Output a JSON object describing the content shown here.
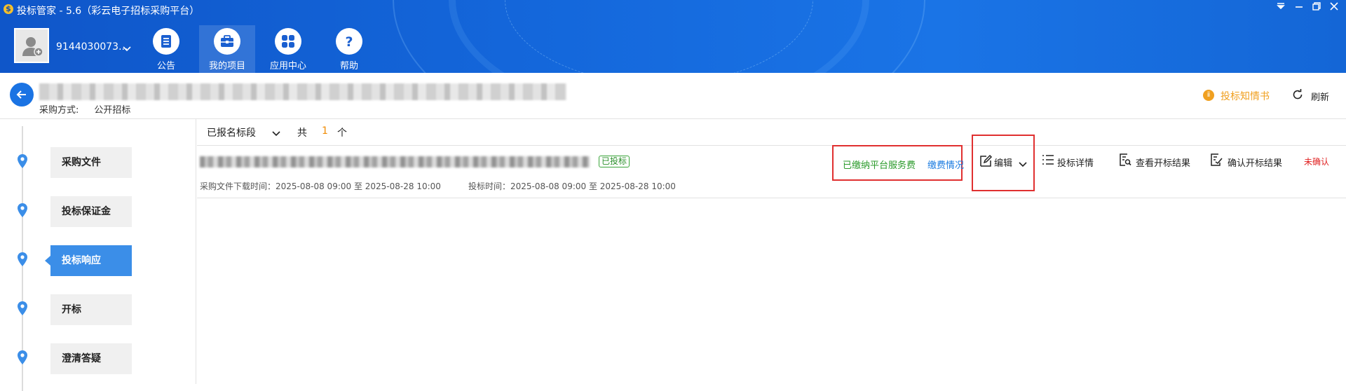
{
  "window": {
    "title": "投标管家 - 5.6（彩云电子招标采购平台）",
    "controls": [
      "dropdown-icon",
      "minimize-icon",
      "restore-icon",
      "close-icon"
    ]
  },
  "header": {
    "account": "9144030073...",
    "nav": [
      {
        "label": "公告",
        "icon": "notice-icon",
        "active": false
      },
      {
        "label": "我的项目",
        "icon": "briefcase-icon",
        "active": true
      },
      {
        "label": "应用中心",
        "icon": "apps-icon",
        "active": false
      },
      {
        "label": "帮助",
        "icon": "help-icon",
        "active": false
      }
    ]
  },
  "project": {
    "method_label": "采购方式:",
    "method_value": "公开招标",
    "guide_label": "投标知情书",
    "refresh_label": "刷新"
  },
  "steps": [
    {
      "label": "采购文件",
      "active": false
    },
    {
      "label": "投标保证金",
      "active": false
    },
    {
      "label": "投标响应",
      "active": true
    },
    {
      "label": "开标",
      "active": false
    },
    {
      "label": "澄清答疑",
      "active": false
    }
  ],
  "toolbar": {
    "segment_label": "已报名标段",
    "total_prefix": "共",
    "total_count": "1",
    "total_unit": "个"
  },
  "lot": {
    "badge": "已投标",
    "download_time": "采购文件下载时间：2025-08-08 09:00 至 2025-08-28 10:00",
    "bid_time": "投标时间：2025-08-08 09:00 至 2025-08-28 10:00",
    "fee_status": "已缴纳平台服务费",
    "fee_info": "缴费情况",
    "edit_label": "编辑",
    "bid_detail": "投标详情",
    "view_result": "查看开标结果",
    "confirm_result": "确认开标结果",
    "confirm_status": "未确认"
  },
  "colors": {
    "header_blue": "#1467db",
    "accent": "#1a73e3",
    "active_step": "#3b8ee8",
    "highlight_red": "#e03030",
    "fee_green": "#2a9a2a",
    "guide_orange": "#f0a020",
    "warn_red": "#e02020"
  }
}
